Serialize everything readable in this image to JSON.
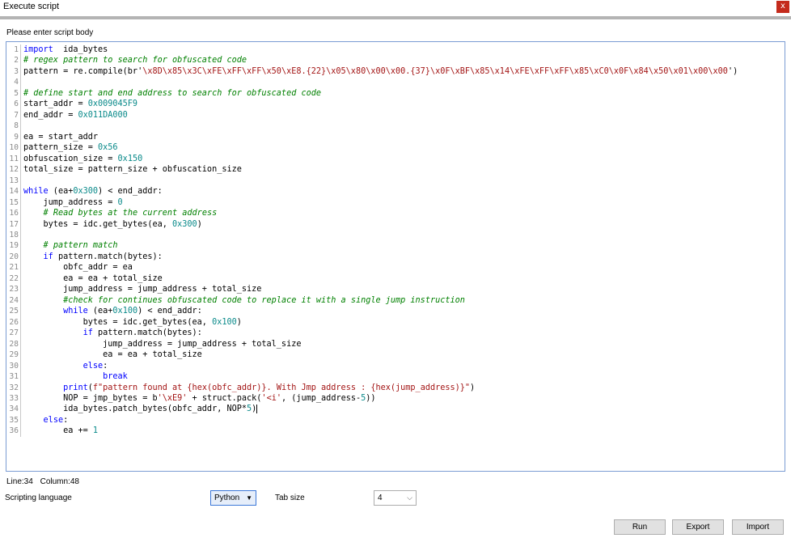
{
  "window": {
    "title": "Execute script",
    "close_label": "x"
  },
  "prompt": {
    "label": "Please enter script body"
  },
  "editor": {
    "lines": [
      {
        "n": "1",
        "tokens": [
          [
            "kw",
            "import"
          ],
          [
            "",
            "  ida_bytes"
          ]
        ]
      },
      {
        "n": "2",
        "tokens": [
          [
            "cm",
            "# regex pattern to search for obfuscated code"
          ]
        ]
      },
      {
        "n": "3",
        "tokens": [
          [
            "",
            "pattern = re.compile(br'"
          ],
          [
            "str",
            "\\x8D\\x85\\x3C\\xFE\\xFF\\xFF\\x50\\xE8.{22}\\x05\\x80\\x00\\x00.{37}\\x0F\\xBF\\x85\\x14\\xFE\\xFF\\xFF\\x85\\xC0\\x0F\\x84\\x50\\x01\\x00\\x00"
          ],
          [
            "",
            "')"
          ]
        ]
      },
      {
        "n": "4",
        "tokens": []
      },
      {
        "n": "5",
        "tokens": [
          [
            "cm",
            "# define start and end address to search for obfuscated code"
          ]
        ]
      },
      {
        "n": "6",
        "tokens": [
          [
            "",
            "start_addr = "
          ],
          [
            "num",
            "0x009045F9"
          ]
        ]
      },
      {
        "n": "7",
        "tokens": [
          [
            "",
            "end_addr = "
          ],
          [
            "num",
            "0x011DA000"
          ]
        ]
      },
      {
        "n": "8",
        "tokens": []
      },
      {
        "n": "9",
        "tokens": [
          [
            "",
            "ea = start_addr"
          ]
        ]
      },
      {
        "n": "10",
        "tokens": [
          [
            "",
            "pattern_size = "
          ],
          [
            "num",
            "0x56"
          ]
        ]
      },
      {
        "n": "11",
        "tokens": [
          [
            "",
            "obfuscation_size = "
          ],
          [
            "num",
            "0x150"
          ]
        ]
      },
      {
        "n": "12",
        "tokens": [
          [
            "",
            "total_size = pattern_size + obfuscation_size"
          ]
        ]
      },
      {
        "n": "13",
        "tokens": []
      },
      {
        "n": "14",
        "tokens": [
          [
            "kw",
            "while"
          ],
          [
            "",
            " (ea+"
          ],
          [
            "num",
            "0x300"
          ],
          [
            "",
            ") < end_addr:"
          ]
        ]
      },
      {
        "n": "15",
        "tokens": [
          [
            "",
            "    jump_address = "
          ],
          [
            "num",
            "0"
          ]
        ]
      },
      {
        "n": "16",
        "tokens": [
          [
            "",
            "    "
          ],
          [
            "cm",
            "# Read bytes at the current address"
          ]
        ]
      },
      {
        "n": "17",
        "tokens": [
          [
            "",
            "    bytes = idc.get_bytes(ea, "
          ],
          [
            "num",
            "0x300"
          ],
          [
            "",
            ")"
          ]
        ]
      },
      {
        "n": "18",
        "tokens": []
      },
      {
        "n": "19",
        "tokens": [
          [
            "",
            "    "
          ],
          [
            "cm",
            "# pattern match"
          ]
        ]
      },
      {
        "n": "20",
        "tokens": [
          [
            "",
            "    "
          ],
          [
            "kw",
            "if"
          ],
          [
            "",
            " pattern.match(bytes):"
          ]
        ]
      },
      {
        "n": "21",
        "tokens": [
          [
            "",
            "        obfc_addr = ea"
          ]
        ]
      },
      {
        "n": "22",
        "tokens": [
          [
            "",
            "        ea = ea + total_size"
          ]
        ]
      },
      {
        "n": "23",
        "tokens": [
          [
            "",
            "        jump_address = jump_address + total_size"
          ]
        ]
      },
      {
        "n": "24",
        "tokens": [
          [
            "",
            "        "
          ],
          [
            "cm",
            "#check for continues obfuscated code to replace it with a single jump instruction"
          ]
        ]
      },
      {
        "n": "25",
        "tokens": [
          [
            "",
            "        "
          ],
          [
            "kw",
            "while"
          ],
          [
            "",
            " (ea+"
          ],
          [
            "num",
            "0x100"
          ],
          [
            "",
            ") < end_addr:"
          ]
        ]
      },
      {
        "n": "26",
        "tokens": [
          [
            "",
            "            bytes = idc.get_bytes(ea, "
          ],
          [
            "num",
            "0x100"
          ],
          [
            "",
            ")"
          ]
        ]
      },
      {
        "n": "27",
        "tokens": [
          [
            "",
            "            "
          ],
          [
            "kw",
            "if"
          ],
          [
            "",
            " pattern.match(bytes):"
          ]
        ]
      },
      {
        "n": "28",
        "tokens": [
          [
            "",
            "                jump_address = jump_address + total_size"
          ]
        ]
      },
      {
        "n": "29",
        "tokens": [
          [
            "",
            "                ea = ea + total_size"
          ]
        ]
      },
      {
        "n": "30",
        "tokens": [
          [
            "",
            "            "
          ],
          [
            "kw",
            "else"
          ],
          [
            "",
            ":"
          ]
        ]
      },
      {
        "n": "31",
        "tokens": [
          [
            "",
            "                "
          ],
          [
            "kw",
            "break"
          ]
        ]
      },
      {
        "n": "32",
        "tokens": [
          [
            "",
            "        "
          ],
          [
            "kw",
            "print"
          ],
          [
            "",
            "("
          ],
          [
            "str",
            "f\"pattern found at {hex(obfc_addr)}. With Jmp address : {hex(jump_address)}\""
          ],
          [
            "",
            ")"
          ]
        ]
      },
      {
        "n": "33",
        "tokens": [
          [
            "",
            "        NOP = jmp_bytes = b"
          ],
          [
            "str",
            "'\\xE9'"
          ],
          [
            "",
            " + struct.pack("
          ],
          [
            "str",
            "'<i'"
          ],
          [
            "",
            ", (jump_address-"
          ],
          [
            "num",
            "5"
          ],
          [
            "",
            "))"
          ]
        ]
      },
      {
        "n": "34",
        "tokens": [
          [
            "",
            "        ida_bytes.patch_bytes(obfc_addr, NOP*"
          ],
          [
            "num",
            "5"
          ],
          [
            "",
            ")"
          ]
        ],
        "caret": true
      },
      {
        "n": "35",
        "tokens": [
          [
            "",
            "    "
          ],
          [
            "kw",
            "else"
          ],
          [
            "",
            ":"
          ]
        ]
      },
      {
        "n": "36",
        "tokens": [
          [
            "",
            "        ea += "
          ],
          [
            "num",
            "1"
          ]
        ]
      }
    ]
  },
  "status": {
    "line": "Line:34",
    "column": "Column:48"
  },
  "options": {
    "language_label": "Scripting language",
    "language_value": "Python",
    "tab_label": "Tab size",
    "tab_value": "4"
  },
  "buttons": {
    "run": "Run",
    "export": "Export",
    "import": "Import"
  },
  "colors": {
    "keyword": "#0000ff",
    "number": "#0a8a8a",
    "string": "#a31515",
    "comment": "#008000",
    "close": "#c42b1c",
    "editor_border": "#7a9cd3"
  }
}
